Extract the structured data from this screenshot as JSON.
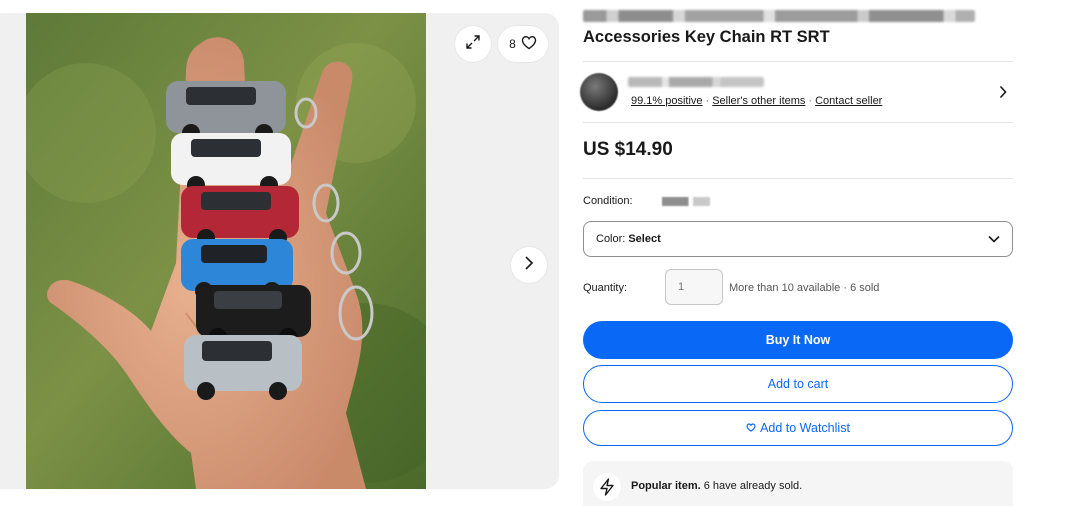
{
  "gallery": {
    "watch_count": "8",
    "icons": [
      "expand-icon",
      "heart-icon",
      "chevron-right-icon"
    ]
  },
  "listing": {
    "title_line2": "Accessories Key Chain RT SRT",
    "price": "US $14.90"
  },
  "seller": {
    "feedback": "99.1% positive",
    "other_items": "Seller's other items",
    "contact": "Contact seller"
  },
  "condition": {
    "label": "Condition:"
  },
  "variation": {
    "label": "Color:",
    "value": "Select"
  },
  "quantity": {
    "label": "Quantity:",
    "placeholder": "1",
    "availability": "More than 10 available · 6 sold"
  },
  "actions": {
    "buy_now": "Buy It Now",
    "add_to_cart": "Add to cart",
    "add_to_watchlist": "Add to Watchlist"
  },
  "popular": {
    "title": "Popular item.",
    "text": "6 have already sold."
  },
  "colors": {
    "accent": "#0968f6",
    "text": "#191919"
  }
}
